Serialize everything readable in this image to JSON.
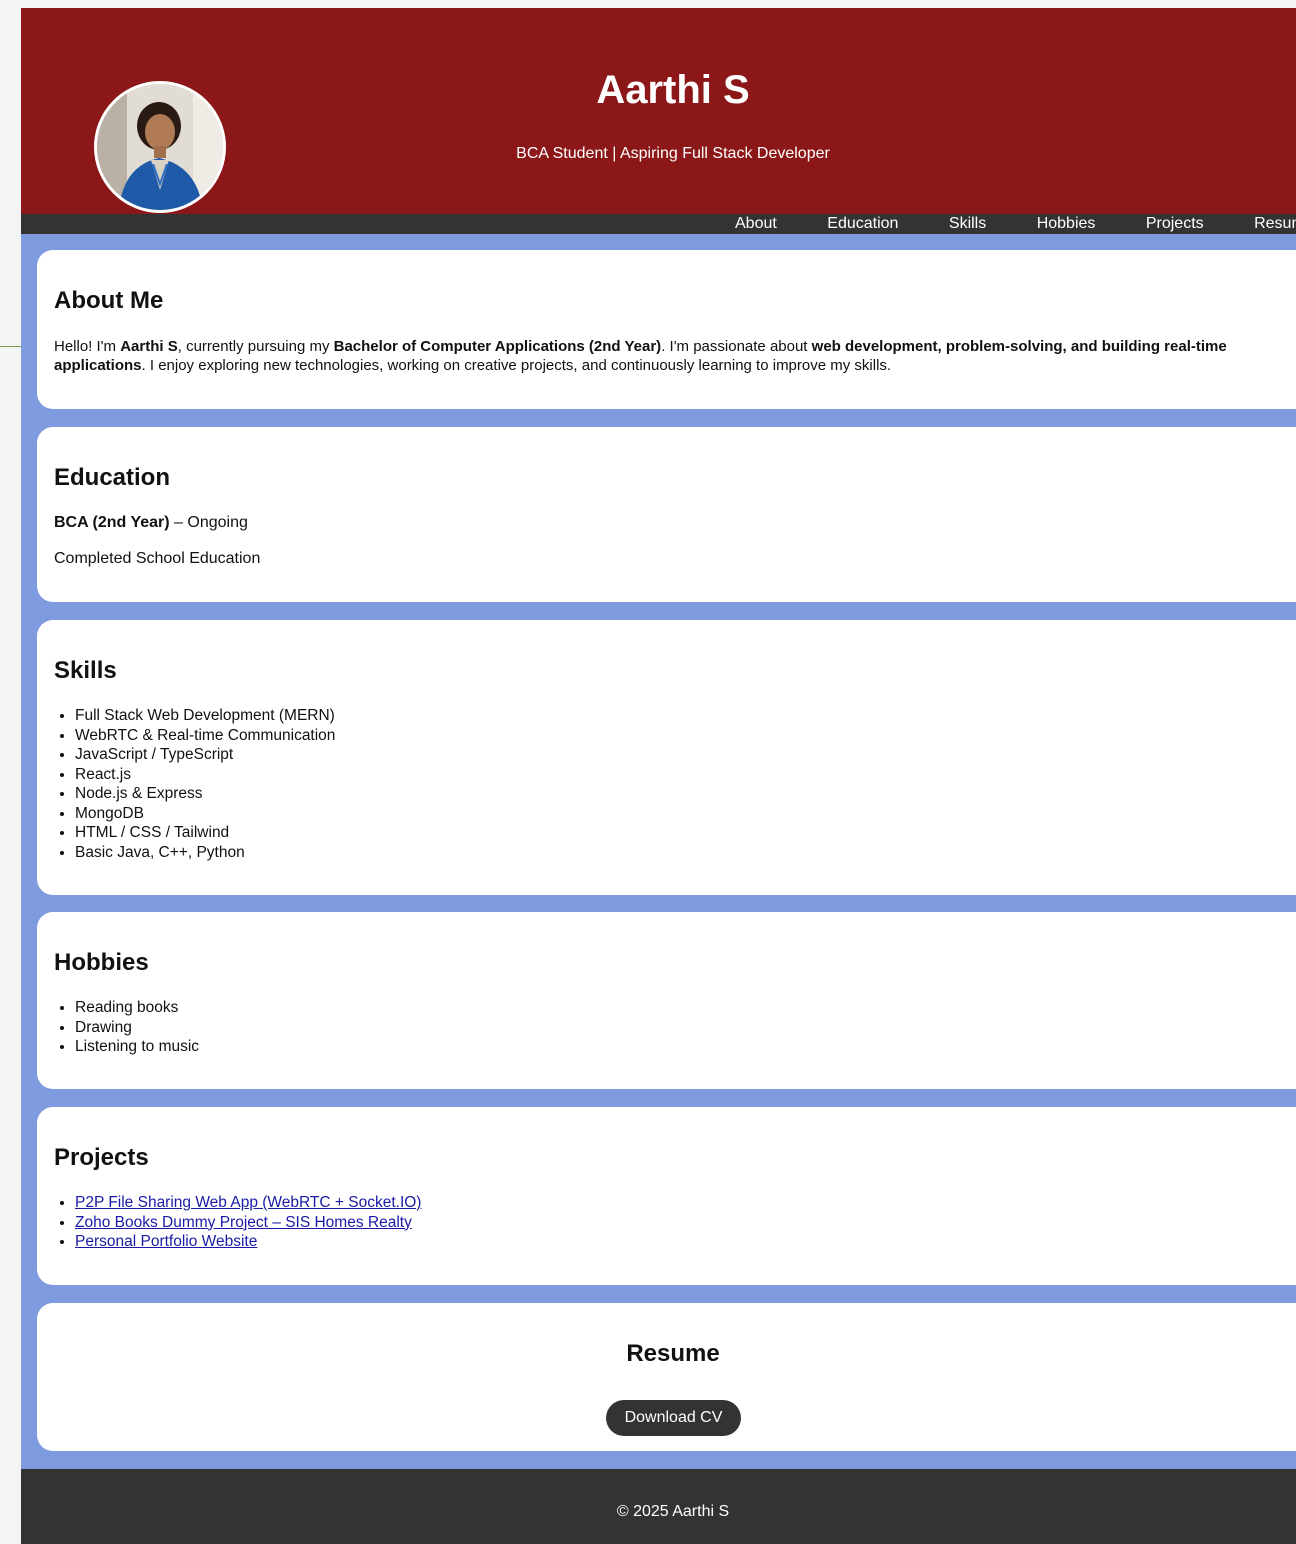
{
  "header": {
    "name": "Aarthi S",
    "subtitle": "BCA Student | Aspiring Full Stack Developer",
    "avatar_icon": "profile-photo"
  },
  "nav": {
    "items": [
      "About",
      "Education",
      "Skills",
      "Hobbies",
      "Projects",
      "Resume"
    ]
  },
  "about": {
    "title": "About Me",
    "t1": "Hello! I'm ",
    "b1": "Aarthi S",
    "t2": ", currently pursuing my ",
    "b2": "Bachelor of Computer Applications (2nd Year)",
    "t3": ". I'm passionate about ",
    "b3": "web development, problem-solving, and building real-time applications",
    "t4": ". I enjoy exploring new technologies, working on creative projects, and continuously learning to improve my skills."
  },
  "education": {
    "title": "Education",
    "degree": "BCA (2nd Year)",
    "degree_status": " – Ongoing",
    "school": "Completed School Education"
  },
  "skills": {
    "title": "Skills",
    "items": [
      "Full Stack Web Development (MERN)",
      "WebRTC & Real-time Communication",
      "JavaScript / TypeScript",
      "React.js",
      "Node.js & Express",
      "MongoDB",
      "HTML / CSS / Tailwind",
      "Basic Java, C++, Python"
    ]
  },
  "hobbies": {
    "title": "Hobbies",
    "items": [
      "Reading books",
      "Drawing",
      "Listening to music"
    ]
  },
  "projects": {
    "title": "Projects",
    "items": [
      "P2P File Sharing Web App (WebRTC + Socket.IO)",
      "Zoho Books Dummy Project – SIS Homes Realty",
      "Personal Portfolio Website"
    ]
  },
  "resume": {
    "title": "Resume",
    "button": "Download CV"
  },
  "footer": {
    "text": "© 2025 Aarthi S"
  },
  "colors": {
    "header_bg": "#8c1719",
    "nav_bg": "#333333",
    "page_bg": "#7f9be0",
    "card_bg": "#ffffff",
    "link": "#1a1aa6"
  }
}
